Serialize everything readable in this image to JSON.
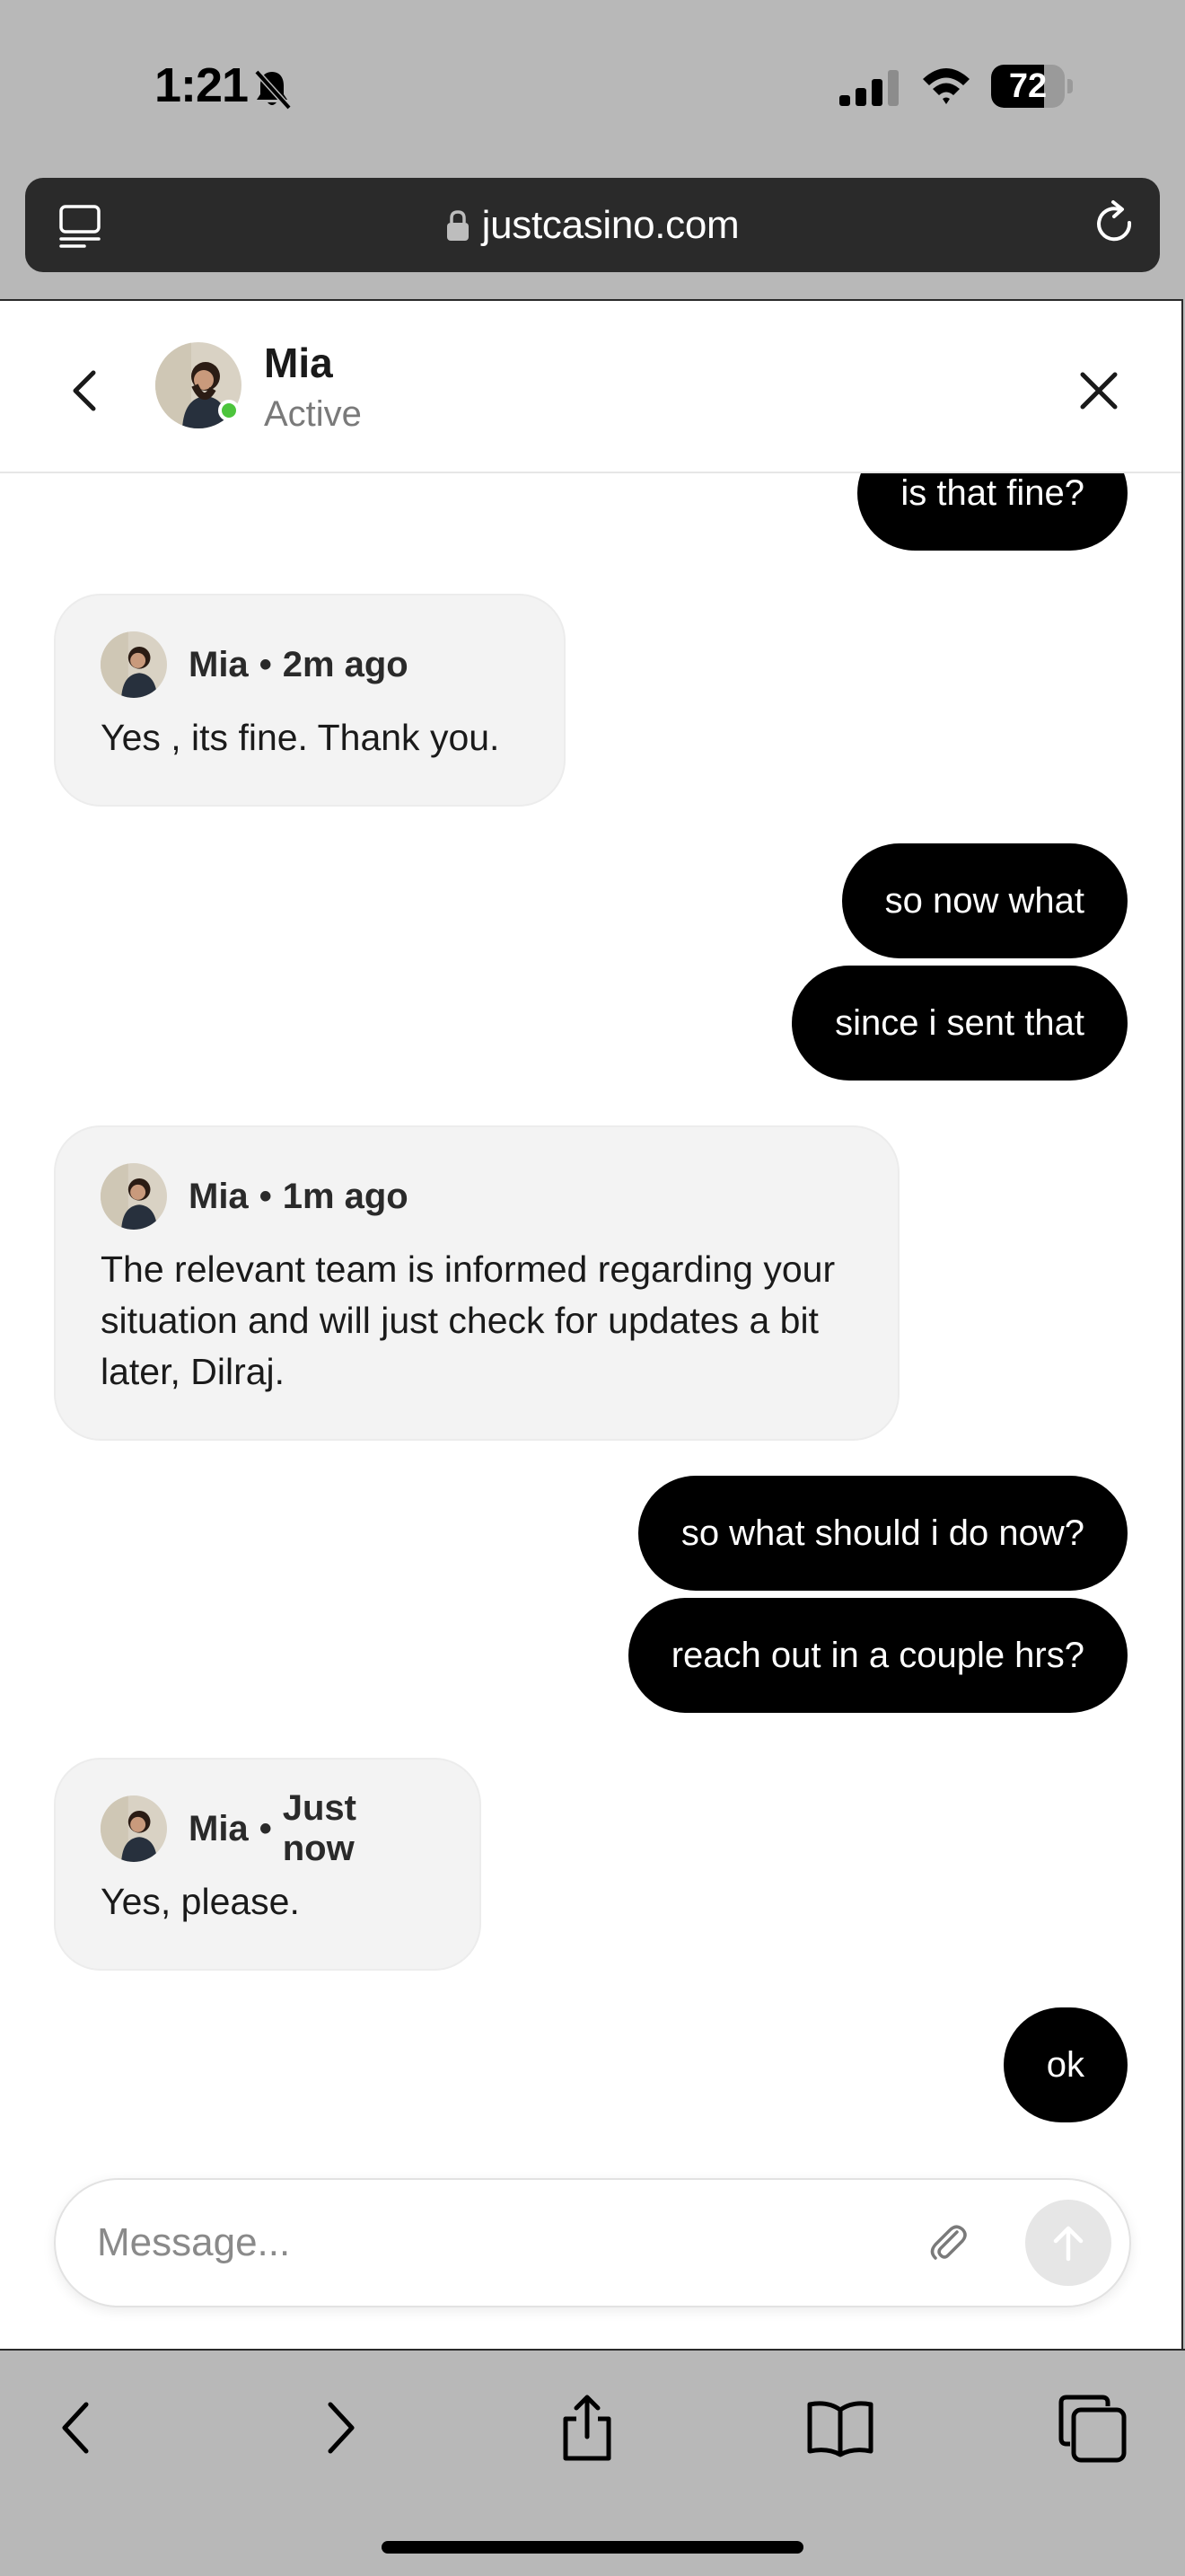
{
  "status_bar": {
    "time": "1:21",
    "battery": "72",
    "battery_level": 0.72,
    "icons": [
      "bell-slash-icon",
      "signal-icon",
      "wifi-icon",
      "battery-icon"
    ]
  },
  "browser": {
    "url": "justcasino.com",
    "icons": [
      "tabs-icon",
      "lock-icon",
      "reload-icon"
    ]
  },
  "chat": {
    "agent_name": "Mia",
    "agent_status": "Active",
    "colors": {
      "online": "#4cc43c",
      "outgoing_bubble": "#000000",
      "incoming_bubble": "#f3f3f3"
    },
    "messages": [
      {
        "type": "out",
        "text": "is that fine?"
      },
      {
        "type": "in",
        "name": "Mia",
        "sep": "•",
        "time": "2m ago",
        "text": "Yes , its fine. Thank you."
      },
      {
        "type": "out",
        "text": "so now what"
      },
      {
        "type": "out",
        "text": "since i sent that"
      },
      {
        "type": "in",
        "name": "Mia",
        "sep": "•",
        "time": "1m ago",
        "text": "The relevant team is informed regarding your situation and will just check for updates a bit later, Dilraj."
      },
      {
        "type": "out",
        "text": "so what should i do now?"
      },
      {
        "type": "out",
        "text": "reach out in a couple hrs?"
      },
      {
        "type": "in",
        "name": "Mia",
        "sep": "•",
        "time": "Just now",
        "text": "Yes, please."
      },
      {
        "type": "out",
        "text": "ok"
      }
    ],
    "composer": {
      "placeholder": "Message..."
    }
  },
  "toolbar": {
    "icons": [
      "back-arrow-icon",
      "forward-arrow-icon",
      "share-icon",
      "bookmarks-icon",
      "tabs-overview-icon"
    ]
  }
}
